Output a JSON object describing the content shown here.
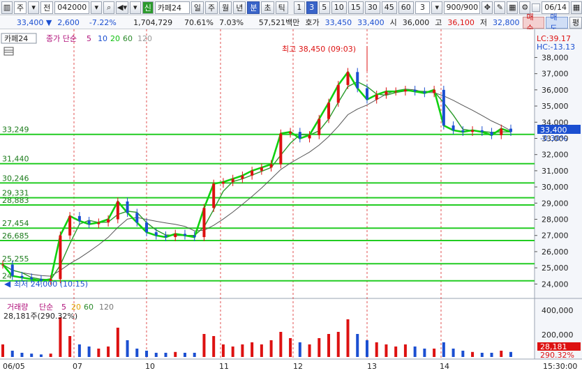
{
  "toolbar": {
    "mode": "주",
    "type": "전",
    "code": "042000",
    "indicator_tag": "신",
    "indicator_name": "카페24",
    "periods": [
      "일",
      "주",
      "월",
      "년",
      "분",
      "초",
      "틱"
    ],
    "active_period": "분",
    "intervals": [
      "1",
      "3",
      "5",
      "10",
      "15",
      "30",
      "45",
      "60"
    ],
    "active_interval": "3",
    "interval_select": "3",
    "count": "900/900",
    "date": "06/14"
  },
  "info": {
    "price": "33,400",
    "change": "2,600",
    "change_pct": "-7.22%",
    "volume": "1,704,729",
    "vol_ratio": "70.61%",
    "turnover": "7.03%",
    "amount": "57,521백만",
    "ask_label": "호가",
    "ask": "33,450",
    "bid": "33,400",
    "open_label": "시",
    "open": "36,000",
    "high_label": "고",
    "high": "36,100",
    "low_label": "저",
    "low": "32,800",
    "buy_label": "매수",
    "sell_label": "매도",
    "eval_label": "평"
  },
  "price_panel": {
    "tab": "카페24",
    "legend_prefix": "종가 단순",
    "ma_labels": [
      "5",
      "10",
      "20",
      "60",
      "120"
    ],
    "lc": "LC:39.17",
    "hc": "HC:-13.13",
    "max_label": "최고 38,450 (09:03)",
    "min_label": "최저 24,000 (10:15)",
    "current_price": "33,400",
    "current_pct": "-0.30%",
    "level_labels": [
      "33,249",
      "31,440",
      "30,246",
      "29,331",
      "28,883",
      "27,454",
      "26,685",
      "25,255",
      "24"
    ],
    "axis_ticks": [
      "38,000",
      "37,000",
      "36,000",
      "35,000",
      "34,000",
      "33,000",
      "32,000",
      "31,000",
      "30,000",
      "29,000",
      "28,000",
      "27,000",
      "26,000",
      "25,000",
      "24,000"
    ]
  },
  "volume_panel": {
    "title": "거래량",
    "legend_prefix": "단순",
    "ma_labels": [
      "5",
      "20",
      "60",
      "120"
    ],
    "current": "28,181주(290.32%)",
    "axis_ticks": [
      "400,000",
      "200,000"
    ],
    "current_badge": "28,181",
    "current_badge_pct": "290.32%"
  },
  "x_axis": {
    "labels": [
      "06/05",
      "07",
      "10",
      "11",
      "12",
      "13",
      "14"
    ],
    "time": "15:30:00"
  },
  "colors": {
    "up": "#dd1111",
    "down": "#1b4fd1",
    "level": "#22cc22",
    "ma5": "#10d010",
    "ma20": "#2a9a2a",
    "ma60": "#555555"
  },
  "chart_data": {
    "type": "line",
    "title": "",
    "xlabel": "",
    "ylabel": "",
    "ylim": [
      23800,
      38450
    ],
    "x": [
      "06/05",
      "07",
      "10",
      "11",
      "12",
      "13",
      "14"
    ],
    "series": [
      {
        "name": "종가",
        "values": [
          25200,
          24500,
          24400,
          24300,
          24200,
          24300,
          27000,
          28200,
          27900,
          27700,
          27800,
          28000,
          29100,
          28400,
          27800,
          27200,
          27000,
          26900,
          27100,
          27000,
          26900,
          28700,
          30200,
          30300,
          30500,
          30700,
          31000,
          31200,
          31400,
          33300,
          33400,
          33000,
          33200,
          34200,
          35200,
          36300,
          37100,
          36100,
          35400,
          35700,
          35900,
          35900,
          36000,
          35900,
          35800,
          36000,
          33800,
          33500,
          33400,
          33500,
          33400,
          33200,
          33600,
          33400
        ]
      }
    ],
    "levels": [
      33249,
      31440,
      30246,
      29331,
      28883,
      27454,
      26685,
      25255,
      24200
    ]
  }
}
